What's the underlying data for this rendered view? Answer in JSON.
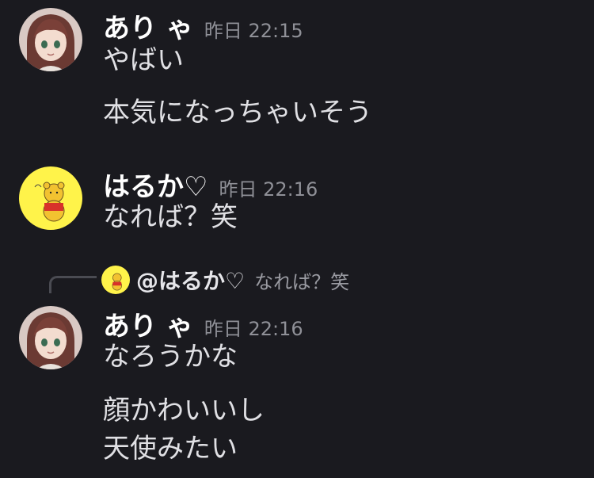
{
  "messages": [
    {
      "username": "あり ゃ",
      "timestamp": "昨日 22:15",
      "lines": [
        "やばい",
        "本気になっちゃいそう"
      ]
    },
    {
      "username": "はるか♡",
      "timestamp": "昨日 22:16",
      "lines": [
        "なれば？笑"
      ]
    },
    {
      "reply": {
        "mention": "@はるか♡",
        "quoted_text": "なれば？笑"
      },
      "username": "あり ゃ",
      "timestamp": "昨日 22:16",
      "lines": [
        "なろうかな",
        "顔かわいいし",
        "天使みたい"
      ]
    }
  ],
  "colors": {
    "background": "#1a1a1f",
    "username": "#ffffff",
    "timestamp": "#8f9097",
    "message": "#e0e0e4",
    "reply_line": "#4a4b52"
  },
  "icons": {
    "avatar_1": "anime-girl-avatar",
    "avatar_2": "yellow-bear-avatar"
  }
}
